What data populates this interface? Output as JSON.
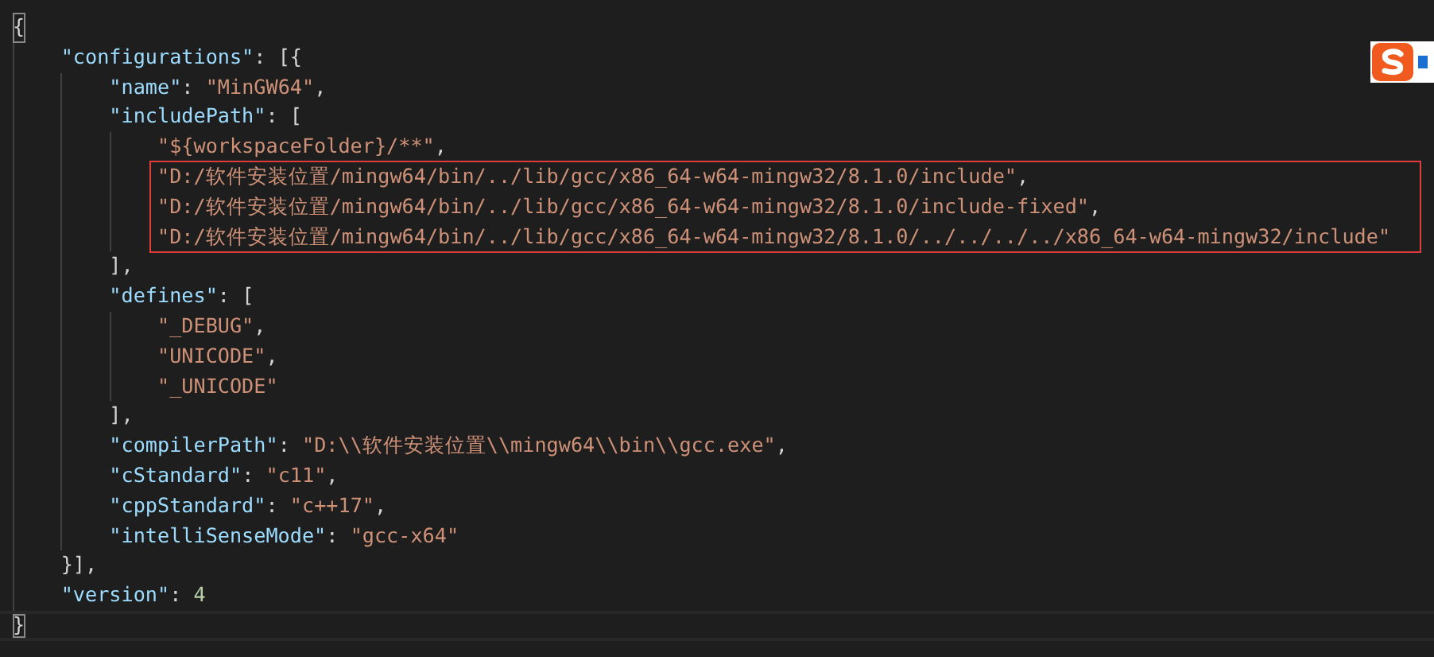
{
  "editor": {
    "lines": [
      {
        "tokens": [
          {
            "kind": "bracket-match",
            "text": "{"
          }
        ],
        "children": [
          {
            "tokens": [
              {
                "kind": "key",
                "text": "\"configurations\""
              },
              {
                "kind": "punct",
                "text": ": [{"
              }
            ],
            "children": [
              {
                "tokens": [
                  {
                    "kind": "key",
                    "text": "\"name\""
                  },
                  {
                    "kind": "punct",
                    "text": ": "
                  },
                  {
                    "kind": "string",
                    "text": "\"MinGW64\""
                  },
                  {
                    "kind": "punct",
                    "text": ","
                  }
                ]
              },
              {
                "tokens": [
                  {
                    "kind": "key",
                    "text": "\"includePath\""
                  },
                  {
                    "kind": "punct",
                    "text": ": ["
                  }
                ],
                "children": [
                  {
                    "tokens": [
                      {
                        "kind": "string",
                        "text": "\"${workspaceFolder}/**\""
                      },
                      {
                        "kind": "punct",
                        "text": ","
                      }
                    ]
                  },
                  {
                    "boxed": true,
                    "tokens": [
                      {
                        "kind": "string",
                        "text": "\"D:/软件安装位置/mingw64/bin/../lib/gcc/x86_64-w64-mingw32/8.1.0/include\""
                      },
                      {
                        "kind": "punct",
                        "text": ","
                      }
                    ]
                  },
                  {
                    "boxed": true,
                    "tokens": [
                      {
                        "kind": "string",
                        "text": "\"D:/软件安装位置/mingw64/bin/../lib/gcc/x86_64-w64-mingw32/8.1.0/include-fixed\""
                      },
                      {
                        "kind": "punct",
                        "text": ","
                      }
                    ]
                  },
                  {
                    "boxed": true,
                    "tokens": [
                      {
                        "kind": "string",
                        "text": "\"D:/软件安装位置/mingw64/bin/../lib/gcc/x86_64-w64-mingw32/8.1.0/../../../../x86_64-w64-mingw32/include\""
                      }
                    ]
                  }
                ]
              },
              {
                "tokens": [
                  {
                    "kind": "punct",
                    "text": "],"
                  }
                ]
              },
              {
                "tokens": [
                  {
                    "kind": "key",
                    "text": "\"defines\""
                  },
                  {
                    "kind": "punct",
                    "text": ": ["
                  }
                ],
                "children": [
                  {
                    "tokens": [
                      {
                        "kind": "string",
                        "text": "\"_DEBUG\""
                      },
                      {
                        "kind": "punct",
                        "text": ","
                      }
                    ]
                  },
                  {
                    "tokens": [
                      {
                        "kind": "string",
                        "text": "\"UNICODE\""
                      },
                      {
                        "kind": "punct",
                        "text": ","
                      }
                    ]
                  },
                  {
                    "tokens": [
                      {
                        "kind": "string",
                        "text": "\"_UNICODE\""
                      }
                    ]
                  }
                ]
              },
              {
                "tokens": [
                  {
                    "kind": "punct",
                    "text": "],"
                  }
                ]
              },
              {
                "tokens": [
                  {
                    "kind": "key",
                    "text": "\"compilerPath\""
                  },
                  {
                    "kind": "punct",
                    "text": ": "
                  },
                  {
                    "kind": "string",
                    "text": "\"D:\\\\软件安装位置\\\\mingw64\\\\bin\\\\gcc.exe\""
                  },
                  {
                    "kind": "punct",
                    "text": ","
                  }
                ]
              },
              {
                "tokens": [
                  {
                    "kind": "key",
                    "text": "\"cStandard\""
                  },
                  {
                    "kind": "punct",
                    "text": ": "
                  },
                  {
                    "kind": "string",
                    "text": "\"c11\""
                  },
                  {
                    "kind": "punct",
                    "text": ","
                  }
                ]
              },
              {
                "tokens": [
                  {
                    "kind": "key",
                    "text": "\"cppStandard\""
                  },
                  {
                    "kind": "punct",
                    "text": ": "
                  },
                  {
                    "kind": "string",
                    "text": "\"c++17\""
                  },
                  {
                    "kind": "punct",
                    "text": ","
                  }
                ]
              },
              {
                "tokens": [
                  {
                    "kind": "key",
                    "text": "\"intelliSenseMode\""
                  },
                  {
                    "kind": "punct",
                    "text": ": "
                  },
                  {
                    "kind": "string",
                    "text": "\"gcc-x64\""
                  }
                ]
              }
            ]
          },
          {
            "tokens": [
              {
                "kind": "punct",
                "text": "}],"
              }
            ]
          },
          {
            "tokens": [
              {
                "kind": "key",
                "text": "\"version\""
              },
              {
                "kind": "punct",
                "text": ": "
              },
              {
                "kind": "number",
                "text": "4"
              }
            ]
          }
        ]
      },
      {
        "current": true,
        "tokens": [
          {
            "kind": "bracket-match",
            "text": "}"
          }
        ]
      }
    ]
  }
}
